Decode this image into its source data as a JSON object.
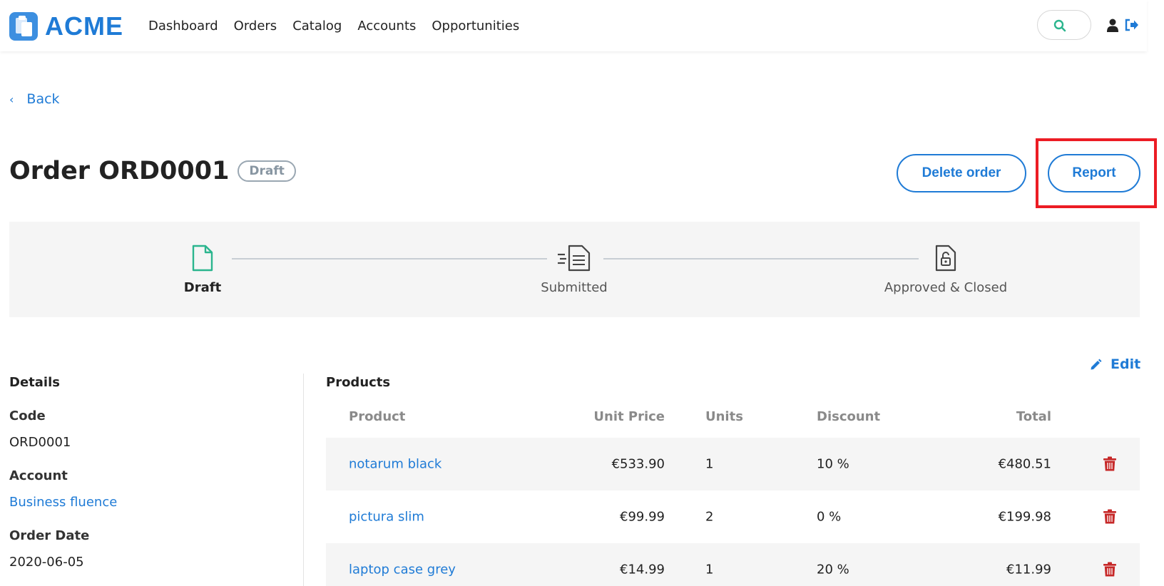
{
  "brand": {
    "name": "ACME"
  },
  "nav": [
    "Dashboard",
    "Orders",
    "Catalog",
    "Accounts",
    "Opportunities"
  ],
  "back_label": "Back",
  "order": {
    "title": "Order ORD0001",
    "status": "Draft"
  },
  "actions": {
    "delete": "Delete order",
    "report": "Report"
  },
  "steps": [
    {
      "label": "Draft",
      "active": true
    },
    {
      "label": "Submitted",
      "active": false
    },
    {
      "label": "Approved & Closed",
      "active": false
    }
  ],
  "details": {
    "title": "Details",
    "code_label": "Code",
    "code": "ORD0001",
    "account_label": "Account",
    "account": "Business fluence",
    "date_label": "Order Date",
    "date": "2020-06-05"
  },
  "products": {
    "title": "Products",
    "edit_label": "Edit",
    "columns": [
      "Product",
      "Unit Price",
      "Units",
      "Discount",
      "Total"
    ],
    "rows": [
      {
        "product": "notarum black",
        "price": "€533.90",
        "units": "1",
        "discount": "10 %",
        "total": "€480.51"
      },
      {
        "product": "pictura slim",
        "price": "€99.99",
        "units": "2",
        "discount": "0 %",
        "total": "€199.98"
      },
      {
        "product": "laptop case grey",
        "price": "€14.99",
        "units": "1",
        "discount": "20 %",
        "total": "€11.99"
      }
    ]
  },
  "colors": {
    "accent": "#1f7bd6",
    "active_step": "#2bb58e",
    "danger": "#c62828",
    "highlight": "#ec1c24"
  },
  "icons": [
    "logo-icon",
    "search-icon",
    "user-icon",
    "logout-icon",
    "chevron-left-icon",
    "document-icon",
    "submitted-document-icon",
    "lock-document-icon",
    "pencil-icon",
    "trash-icon"
  ]
}
